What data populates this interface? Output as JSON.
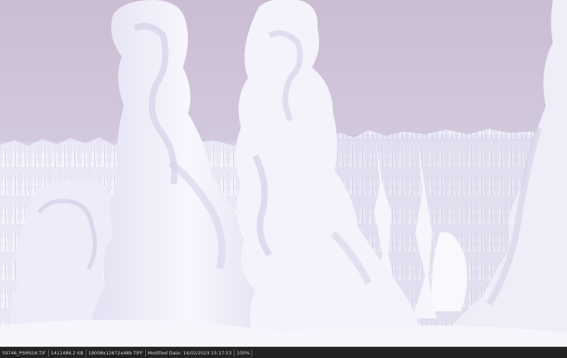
{
  "statusbar": {
    "filename": "59746_PSMS16.TIF",
    "filesize": "1411486.2 KB",
    "dimensions": "19008x12672x48b TIFF",
    "modified": "Modified Date: 14/02/2023 15:17:53",
    "zoom": "100%"
  },
  "colors": {
    "sky_top": "#cdbfd3",
    "sky_bottom": "#dad7ea",
    "snow": "#f3f1fb",
    "shadow": "#cbc8e2",
    "forest": "#e8e6f6",
    "statusbar_bg": "#232323"
  }
}
